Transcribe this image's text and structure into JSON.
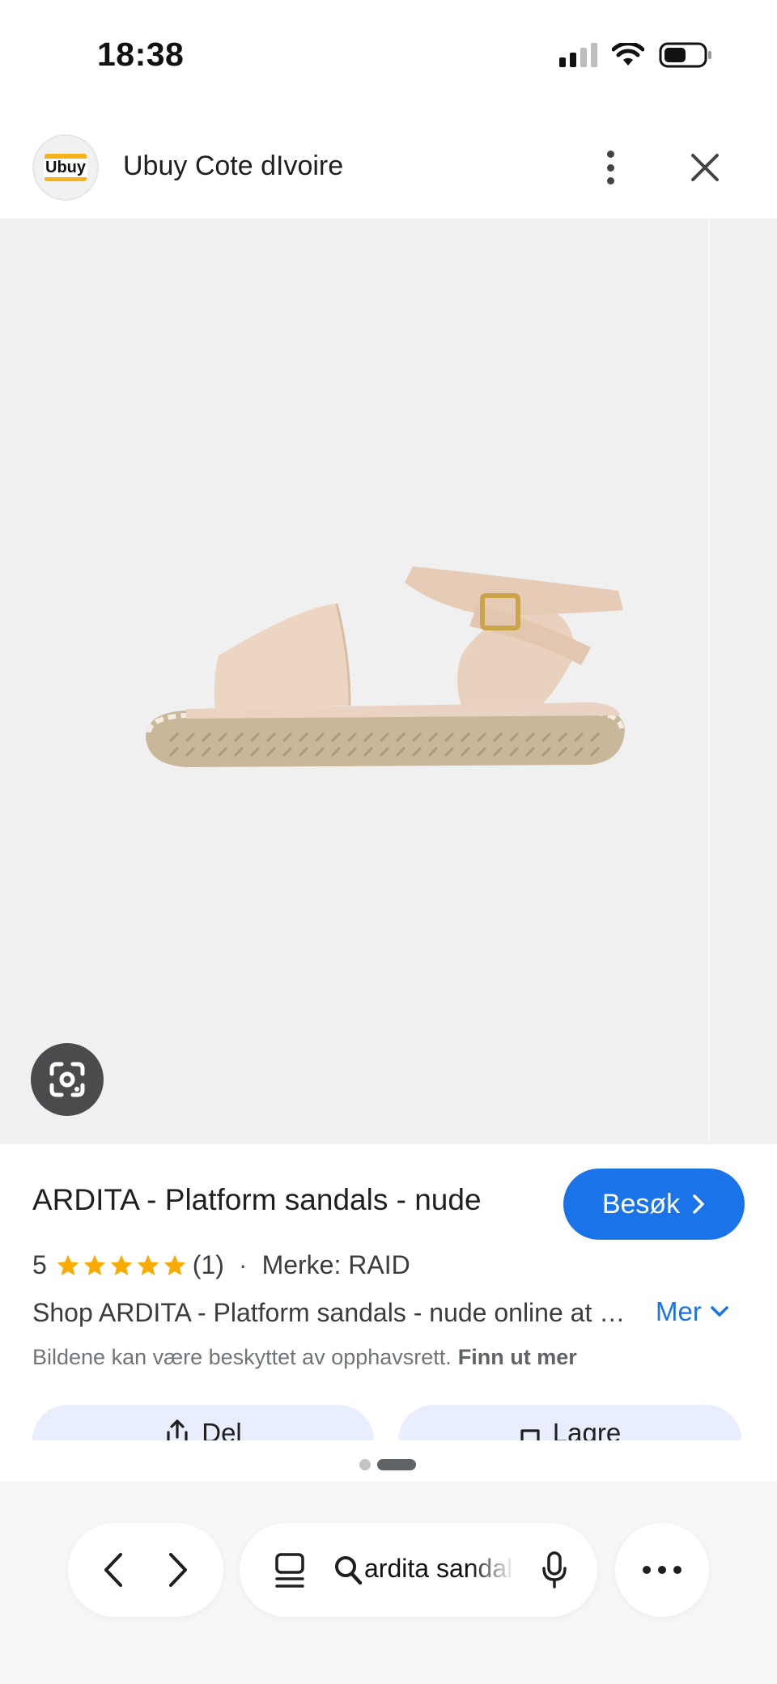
{
  "status_bar": {
    "time": "18:38",
    "icons": [
      "signal-icon",
      "wifi-icon",
      "battery-icon"
    ]
  },
  "header": {
    "site_logo_text": "Ubuy",
    "site_name": "Ubuy Cote dIvoire",
    "icons": [
      "more-vert-icon",
      "close-icon"
    ]
  },
  "image_viewer": {
    "alt": "ARDITA - Platform sandals - nude",
    "lens_icon": "google-lens-icon"
  },
  "product": {
    "title": "ARDITA - Platform sandals - nude",
    "visit_label": "Besøk",
    "rating_value": "5",
    "rating_stars": 5,
    "rating_count": "(1)",
    "separator": "·",
    "brand": "Merke: RAID",
    "description": "Shop ARDITA - Platform sandals - nude online at best prices",
    "more_label": "Mer",
    "copyright_text": "Bildene kan være beskyttet av opphavsrett.",
    "learn_more_label": "Finn ut mer",
    "share_label": "Del",
    "save_label": "Lagre"
  },
  "bottom_bar": {
    "search_query": "ardita sandals",
    "icons": [
      "back-icon",
      "forward-icon",
      "tabs-icon",
      "search-icon",
      "mic-icon",
      "more-horiz-icon"
    ]
  },
  "colors": {
    "accent": "#1a73e8",
    "image_bg": "#f0f0f1",
    "star": "#f9ab00",
    "action_button_bg": "#e8eefd"
  }
}
